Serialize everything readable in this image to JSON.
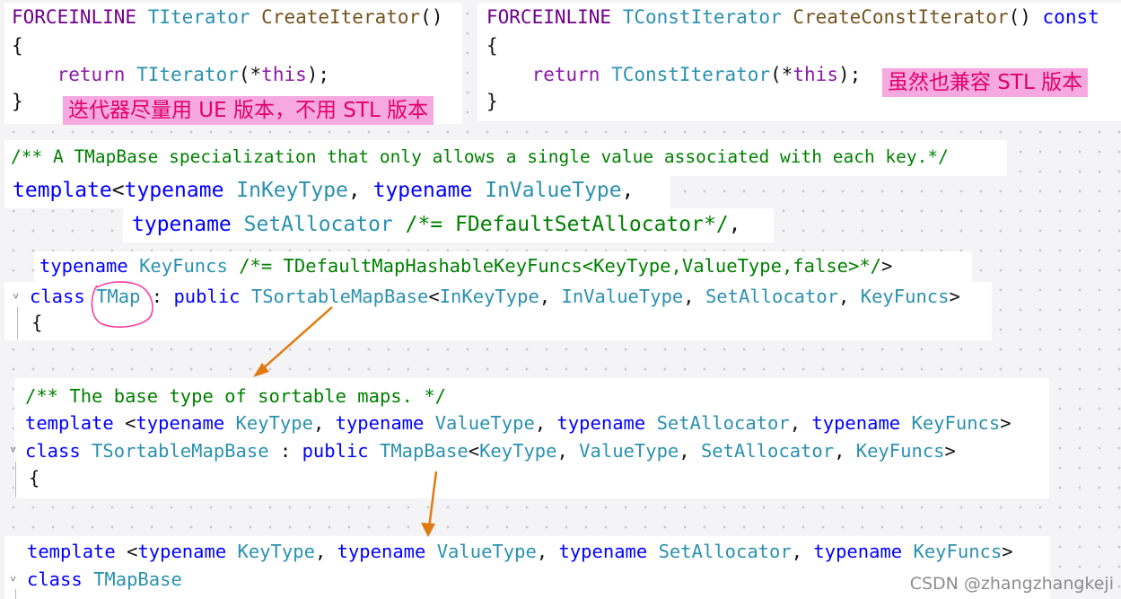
{
  "snippet_iterator": {
    "lines": [
      [
        {
          "t": "FORCEINLINE ",
          "c": "mac"
        },
        {
          "t": "TIterator ",
          "c": "ty"
        },
        {
          "t": "CreateIterator",
          "c": "fn"
        },
        {
          "t": "()",
          "c": "pl"
        }
      ],
      [
        {
          "t": "{",
          "c": "pl"
        }
      ],
      [
        {
          "t": "    return ",
          "c": "kw2"
        },
        {
          "t": "TIterator",
          "c": "ty"
        },
        {
          "t": "(*",
          "c": "pl"
        },
        {
          "t": "this",
          "c": "kw2"
        },
        {
          "t": ");",
          "c": "pl"
        }
      ],
      [
        {
          "t": "}",
          "c": "pl"
        }
      ]
    ],
    "note": "迭代器尽量用 UE 版本，不用 STL 版本"
  },
  "snippet_const_iterator": {
    "lines": [
      [
        {
          "t": "FORCEINLINE ",
          "c": "mac"
        },
        {
          "t": "TConstIterator ",
          "c": "ty"
        },
        {
          "t": "CreateConstIterator",
          "c": "fn"
        },
        {
          "t": "() ",
          "c": "pl"
        },
        {
          "t": "const",
          "c": "kw"
        }
      ],
      [
        {
          "t": "{",
          "c": "pl"
        }
      ],
      [
        {
          "t": "    return ",
          "c": "kw2"
        },
        {
          "t": "TConstIterator",
          "c": "ty"
        },
        {
          "t": "(*",
          "c": "pl"
        },
        {
          "t": "this",
          "c": "kw2"
        },
        {
          "t": ");",
          "c": "pl"
        }
      ],
      [
        {
          "t": "}",
          "c": "pl"
        }
      ]
    ],
    "note": "虽然也兼容 STL 版本"
  },
  "snippet_tmap": {
    "lines": [
      [
        {
          "t": "/** A TMapBase specialization that only allows a single value associated with each key.*/",
          "c": "cm"
        }
      ],
      [
        {
          "t": "template",
          "c": "kw"
        },
        {
          "t": "<",
          "c": "pl"
        },
        {
          "t": "typename ",
          "c": "kw"
        },
        {
          "t": "InKeyType",
          "c": "ty"
        },
        {
          "t": ", ",
          "c": "pl"
        },
        {
          "t": "typename ",
          "c": "kw"
        },
        {
          "t": "InValueType",
          "c": "ty"
        },
        {
          "t": ",",
          "c": "pl"
        }
      ],
      [
        {
          "t": "typename ",
          "c": "kw"
        },
        {
          "t": "SetAllocator ",
          "c": "ty"
        },
        {
          "t": "/*= FDefaultSetAllocator*/",
          "c": "cm"
        },
        {
          "t": ",",
          "c": "pl"
        }
      ],
      [
        {
          "t": "typename ",
          "c": "kw"
        },
        {
          "t": "KeyFuncs ",
          "c": "ty"
        },
        {
          "t": "/*= TDefaultMapHashableKeyFuncs<KeyType,ValueType,false>*/",
          "c": "cm"
        },
        {
          "t": ">",
          "c": "pl"
        }
      ],
      [
        {
          "t": "class ",
          "c": "kw"
        },
        {
          "t": "TMap",
          "c": "ty"
        },
        {
          "t": " : ",
          "c": "pl"
        },
        {
          "t": "public ",
          "c": "kw"
        },
        {
          "t": "TSortableMapBase",
          "c": "ty"
        },
        {
          "t": "<",
          "c": "pl"
        },
        {
          "t": "InKeyType",
          "c": "ty"
        },
        {
          "t": ", ",
          "c": "pl"
        },
        {
          "t": "InValueType",
          "c": "ty"
        },
        {
          "t": ", ",
          "c": "pl"
        },
        {
          "t": "SetAllocator",
          "c": "ty"
        },
        {
          "t": ", ",
          "c": "pl"
        },
        {
          "t": "KeyFuncs",
          "c": "ty"
        },
        {
          "t": ">",
          "c": "pl"
        }
      ],
      [
        {
          "t": "{",
          "c": "pl"
        }
      ]
    ]
  },
  "snippet_sortable": {
    "lines": [
      [
        {
          "t": "/** The base type of sortable maps. */",
          "c": "cm"
        }
      ],
      [
        {
          "t": "template ",
          "c": "kw"
        },
        {
          "t": "<",
          "c": "pl"
        },
        {
          "t": "typename ",
          "c": "kw"
        },
        {
          "t": "KeyType",
          "c": "ty"
        },
        {
          "t": ", ",
          "c": "pl"
        },
        {
          "t": "typename ",
          "c": "kw"
        },
        {
          "t": "ValueType",
          "c": "ty"
        },
        {
          "t": ", ",
          "c": "pl"
        },
        {
          "t": "typename ",
          "c": "kw"
        },
        {
          "t": "SetAllocator",
          "c": "ty"
        },
        {
          "t": ", ",
          "c": "pl"
        },
        {
          "t": "typename ",
          "c": "kw"
        },
        {
          "t": "KeyFuncs",
          "c": "ty"
        },
        {
          "t": ">",
          "c": "pl"
        }
      ],
      [
        {
          "t": "class ",
          "c": "kw"
        },
        {
          "t": "TSortableMapBase",
          "c": "ty"
        },
        {
          "t": " : ",
          "c": "pl"
        },
        {
          "t": "public ",
          "c": "kw"
        },
        {
          "t": "TMapBase",
          "c": "ty"
        },
        {
          "t": "<",
          "c": "pl"
        },
        {
          "t": "KeyType",
          "c": "ty"
        },
        {
          "t": ", ",
          "c": "pl"
        },
        {
          "t": "ValueType",
          "c": "ty"
        },
        {
          "t": ", ",
          "c": "pl"
        },
        {
          "t": "SetAllocator",
          "c": "ty"
        },
        {
          "t": ", ",
          "c": "pl"
        },
        {
          "t": "KeyFuncs",
          "c": "ty"
        },
        {
          "t": ">",
          "c": "pl"
        }
      ],
      [
        {
          "t": "{",
          "c": "pl"
        }
      ]
    ]
  },
  "snippet_mapbase": {
    "lines": [
      [
        {
          "t": "template ",
          "c": "kw"
        },
        {
          "t": "<",
          "c": "pl"
        },
        {
          "t": "typename ",
          "c": "kw"
        },
        {
          "t": "KeyType",
          "c": "ty"
        },
        {
          "t": ", ",
          "c": "pl"
        },
        {
          "t": "typename ",
          "c": "kw"
        },
        {
          "t": "ValueType",
          "c": "ty"
        },
        {
          "t": ", ",
          "c": "pl"
        },
        {
          "t": "typename ",
          "c": "kw"
        },
        {
          "t": "SetAllocator",
          "c": "ty"
        },
        {
          "t": ", ",
          "c": "pl"
        },
        {
          "t": "typename ",
          "c": "kw"
        },
        {
          "t": "KeyFuncs",
          "c": "ty"
        },
        {
          "t": ">",
          "c": "pl"
        }
      ],
      [
        {
          "t": "class ",
          "c": "kw"
        },
        {
          "t": "TMapBase",
          "c": "ty"
        }
      ]
    ]
  },
  "fold_icon": "chevron-down-icon",
  "watermark": "CSDN @zhangzhangkeji"
}
